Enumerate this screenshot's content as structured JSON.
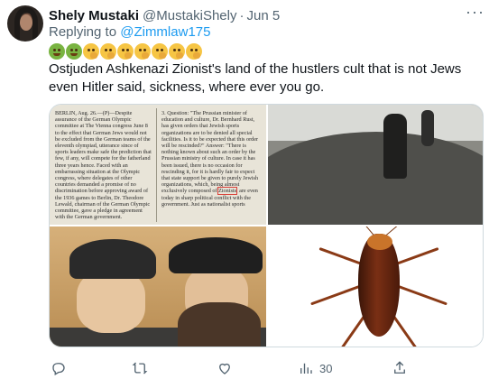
{
  "tweet": {
    "display_name": "Shely Mustaki",
    "handle": "@MustakiShely",
    "separator": "·",
    "date": "Jun 5",
    "more_label": "···",
    "replying_prefix": "Replying to",
    "replying_to": "@Zimmlaw175",
    "emojis": [
      "nauseated-face",
      "nauseated-face",
      "thinking-face",
      "thinking-face",
      "thinking-face",
      "thinking-face",
      "thinking-face",
      "thinking-face",
      "thinking-face"
    ],
    "text": "Ostjuden Ashkenazi Zionist's land of the hustlers cult that is not Jews even Hitler said, sickness, where ever you go."
  },
  "media": {
    "newspaper_left": "BERLIN, Aug. 26.—(P)—Despite assurance of the German Olympic committee at The Vienna congress June 8 to the effect that German Jews would not be excluded from the German teams of the eleventh olympiad, utterance since of sports leaders make safe the prediction that few, if any, will compete for the fatherland three years hence. Faced with an embarrassing situation at the Olympic congress, where delegates of other countries demanded a promise of no discrimination before approving award of the 1936 games to Berlin, Dr. Theodore Lewald, chairman of the German Olympic committee, gave a pledge in agreement with the German government.",
    "newspaper_right_1": "3. Question: \"The Prussian minister of education and culture, Dr. Bernhard Rust, has given orders that Jewish sports organizations are to be denied all special facilities. Is it to be expected that this order will be rescinded?\"",
    "newspaper_right_2": "Answer: \"There is nothing known about such an order by the Prussian ministry of culture. In case it has been issued, there is no occasion for rescinding it, for it is hardly fair to expect that state support be given to purely Jewish organizations, which, being almost exclusively composed of",
    "newspaper_highlight": "Zionists",
    "newspaper_right_3": ", are even today in sharp political conflict with the government. Just as nationalist sports"
  },
  "actions": {
    "reply": {
      "icon": "reply-icon",
      "count": ""
    },
    "retweet": {
      "icon": "retweet-icon",
      "count": ""
    },
    "like": {
      "icon": "like-icon",
      "count": ""
    },
    "views": {
      "icon": "views-icon",
      "count": "30"
    },
    "share": {
      "icon": "share-icon",
      "count": ""
    }
  },
  "colors": {
    "text": "#0f1419",
    "secondary": "#536471",
    "link": "#1d9bf0",
    "border": "#cfd9de"
  }
}
